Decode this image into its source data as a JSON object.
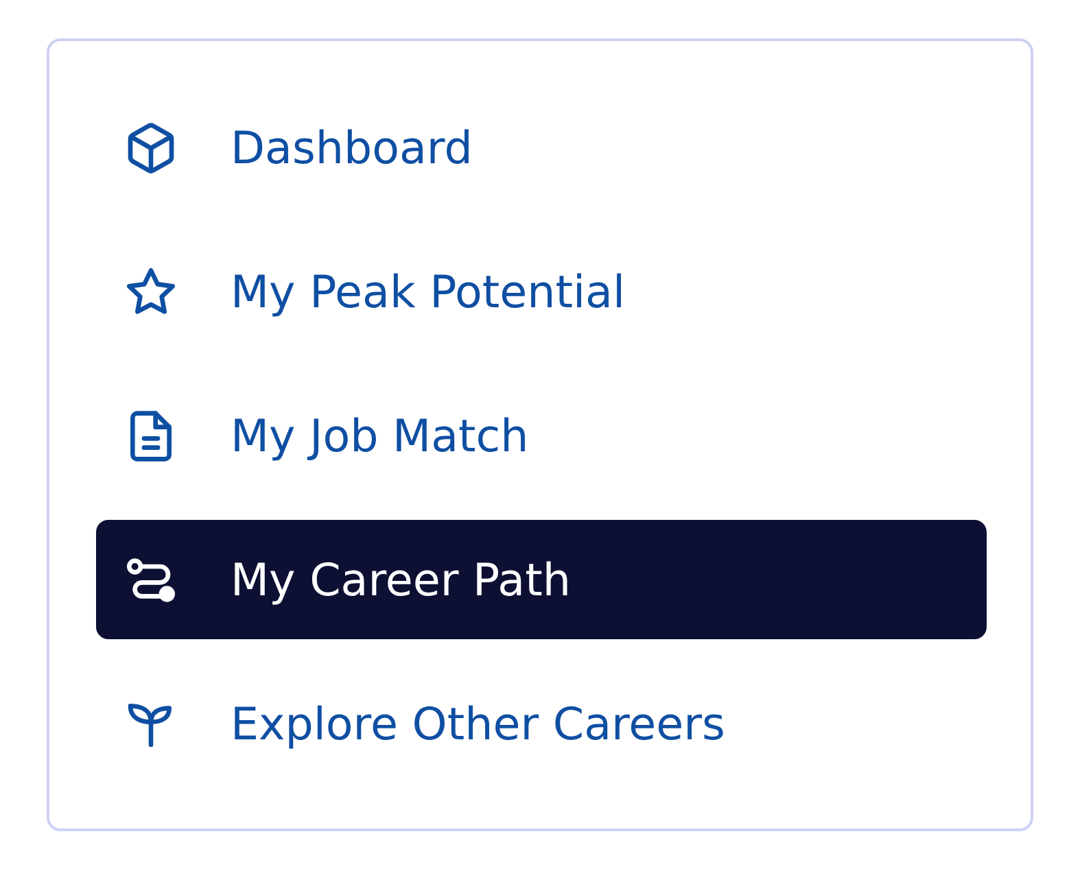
{
  "nav": {
    "items": [
      {
        "label": "Dashboard",
        "selected": false
      },
      {
        "label": "My Peak Potential",
        "selected": false
      },
      {
        "label": "My Job Match",
        "selected": false
      },
      {
        "label": "My Career Path",
        "selected": true
      },
      {
        "label": "Explore Other Careers",
        "selected": false
      }
    ]
  }
}
